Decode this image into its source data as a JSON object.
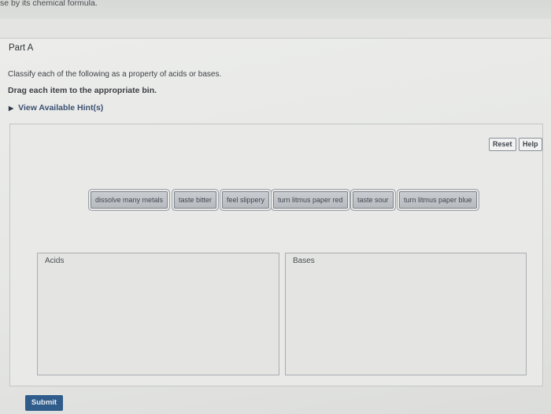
{
  "header": {
    "fragment_text": "se by its chemical formula."
  },
  "part": {
    "title": "Part A"
  },
  "question": {
    "instruction": "Classify each of the following as a property of acids or bases.",
    "drag_text": "Drag each item to the appropriate bin.",
    "hints_label": "View Available Hint(s)"
  },
  "toolbar": {
    "reset_label": "Reset",
    "help_label": "Help"
  },
  "items": [
    "dissolve many metals",
    "taste bitter",
    "feel slippery",
    "turn litmus paper red",
    "taste sour",
    "turn litmus paper blue"
  ],
  "bins": {
    "acids_label": "Acids",
    "bases_label": "Bases"
  },
  "actions": {
    "submit_label": "Submit"
  }
}
